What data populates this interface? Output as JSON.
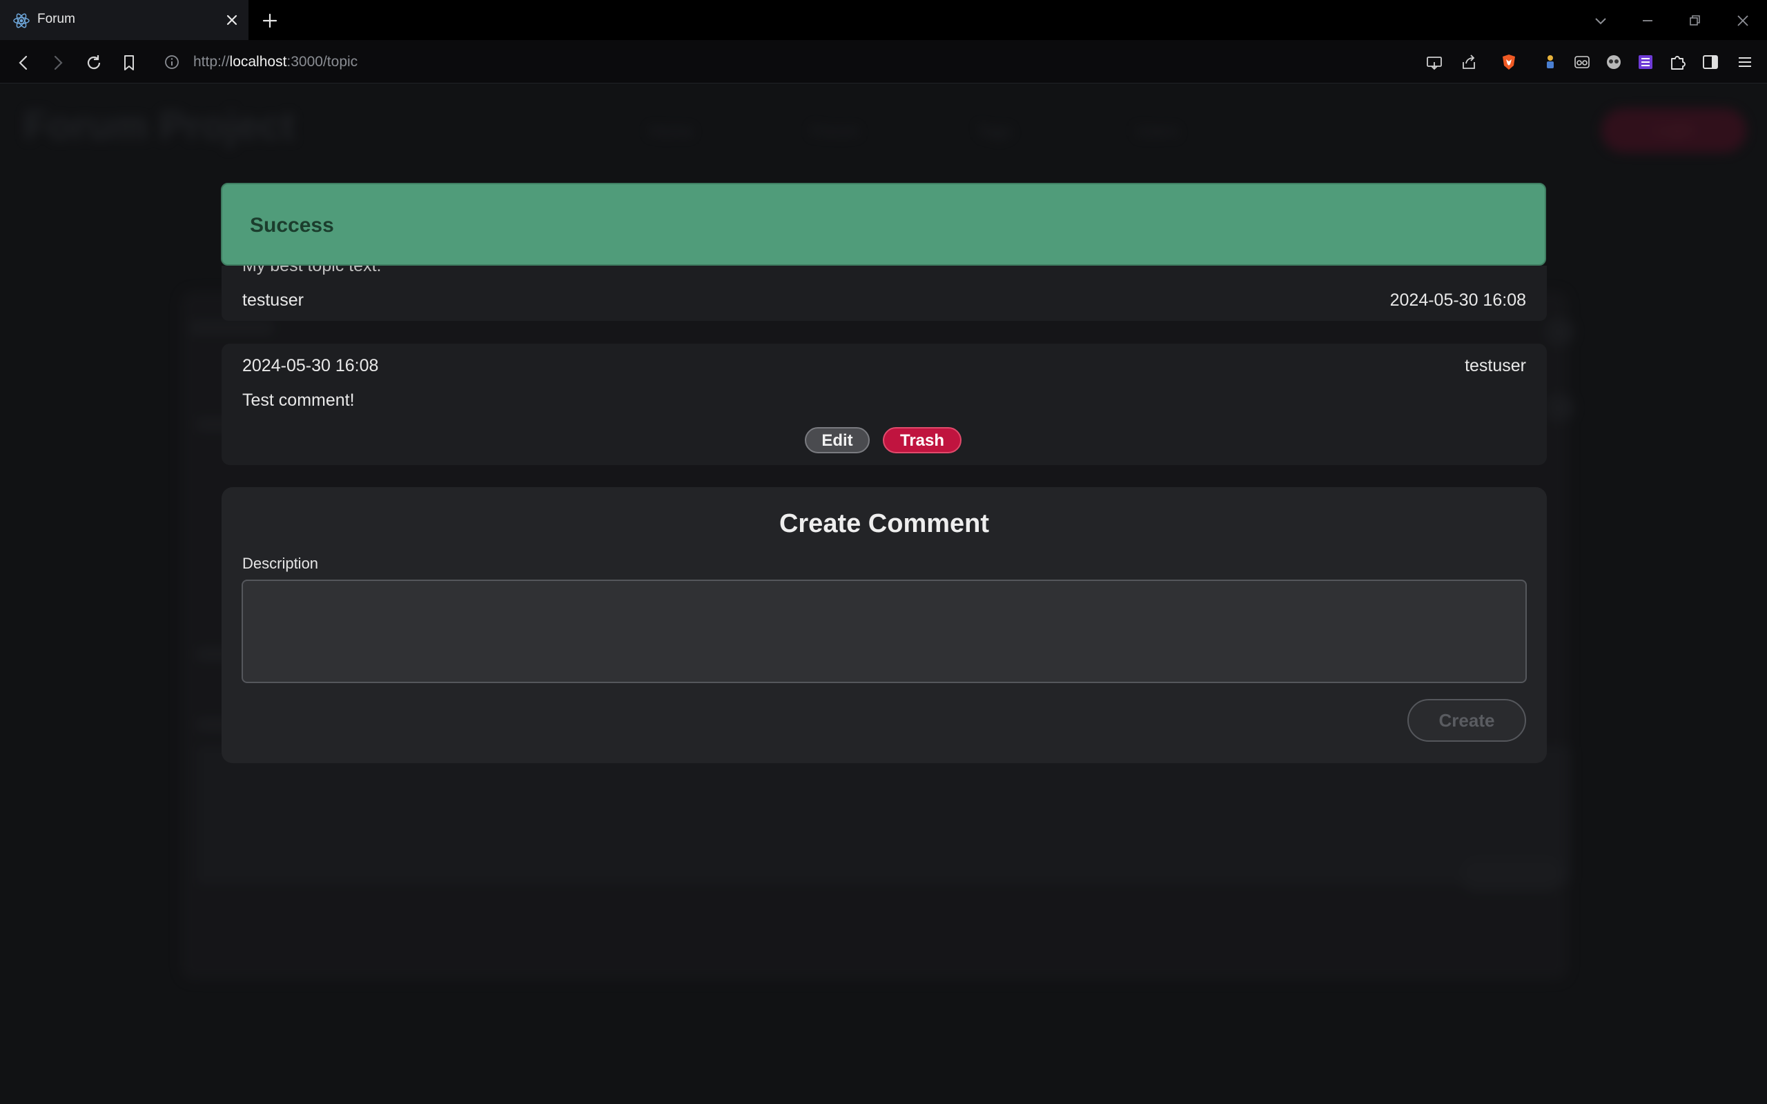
{
  "browser": {
    "tab_title": "Forum",
    "url_protocol": "http://",
    "url_host": "localhost",
    "url_path": ":3000/topic"
  },
  "background": {
    "brand": "Forum Project",
    "nav_items": [
      "Home",
      "Forum",
      "Tags",
      "Users"
    ],
    "login_label": "Login"
  },
  "alert": {
    "text": "Success",
    "color": "#509c7a"
  },
  "topic": {
    "text": "My best topic text.",
    "author": "testuser",
    "date": "2024-05-30 16:08"
  },
  "comment": {
    "date": "2024-05-30 16:08",
    "author": "testuser",
    "body": "Test comment!",
    "edit_label": "Edit",
    "trash_label": "Trash",
    "trash_color": "#c0143f"
  },
  "create_comment": {
    "title": "Create Comment",
    "description_label": "Description",
    "description_value": "",
    "create_label": "Create"
  }
}
